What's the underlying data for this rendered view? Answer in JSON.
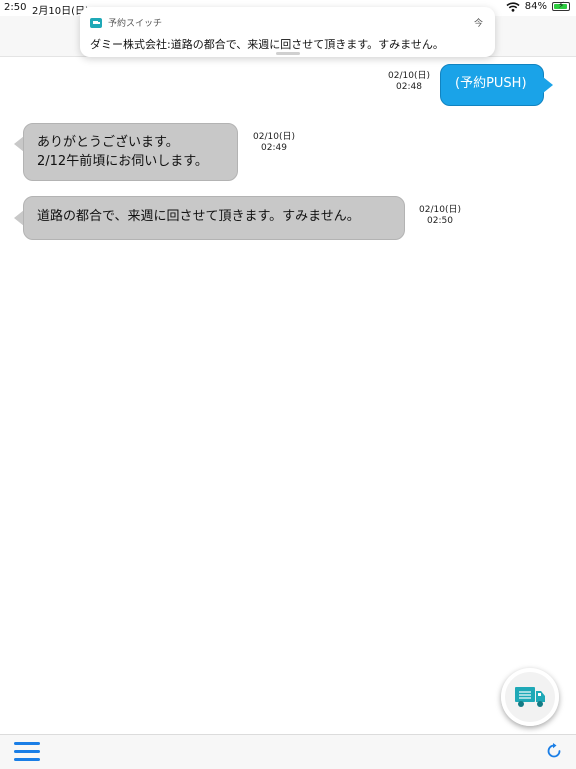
{
  "status_bar": {
    "time": "2:50",
    "date": "2月10日(日)",
    "battery": "84%"
  },
  "notification": {
    "app_name": "予約スイッチ",
    "time": "今",
    "message": "ダミー株式会社:道路の都合で、来週に回させて頂きます。すみません。"
  },
  "messages": [
    {
      "direction": "outgoing",
      "text": [
        "(予約PUSH)"
      ],
      "date": "02/10(日)",
      "time": "02:48"
    },
    {
      "direction": "incoming",
      "text": [
        "ありがとうございます。",
        "2/12午前頃にお伺いします。"
      ],
      "date": "02/10(日)",
      "time": "02:49"
    },
    {
      "direction": "incoming",
      "text": [
        "道路の都合で、来週に回させて頂きます。すみません。"
      ],
      "date": "02/10(日)",
      "time": "02:50"
    }
  ],
  "fab": {
    "icon": "truck-icon"
  },
  "toolbar": {
    "menu_icon": "hamburger-menu-icon",
    "refresh_icon": "refresh-icon"
  },
  "colors": {
    "accent": "#1a7ee6",
    "outgoing_bubble": "#1aa3e8",
    "incoming_bubble": "#c8c8c8",
    "truck": "#1fa9b7"
  }
}
